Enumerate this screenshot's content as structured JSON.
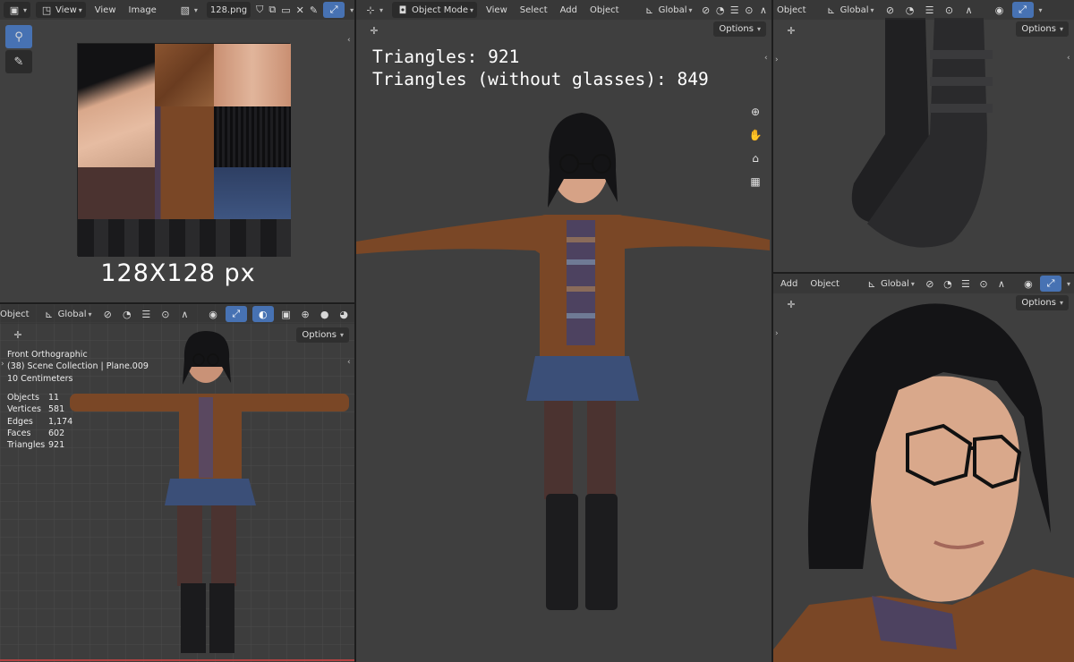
{
  "image_editor": {
    "view_menu": "View",
    "menu_view": "View",
    "menu_image": "Image",
    "image_name": "128.png",
    "texture_caption": "128X128 px"
  },
  "front_viewport": {
    "header_object": "Object",
    "orientation": "Global",
    "options_label": "Options",
    "view_name": "Front Orthographic",
    "collection": "(38) Scene Collection | Plane.009",
    "scale": "10 Centimeters",
    "stats": [
      {
        "label": "Objects",
        "value": "11"
      },
      {
        "label": "Vertices",
        "value": "581"
      },
      {
        "label": "Edges",
        "value": "1,174"
      },
      {
        "label": "Faces",
        "value": "602"
      },
      {
        "label": "Triangles",
        "value": "921"
      }
    ]
  },
  "main_viewport": {
    "mode": "Object Mode",
    "menus": [
      "View",
      "Select",
      "Add",
      "Object"
    ],
    "orientation": "Global",
    "options_label": "Options",
    "overlay_line1": "Triangles: 921",
    "overlay_line2": "Triangles (without glasses): 849"
  },
  "boots_viewport": {
    "header_object": "Object",
    "orientation": "Global",
    "options_label": "Options"
  },
  "face_viewport": {
    "menu_add": "Add",
    "menu_object": "Object",
    "orientation": "Global",
    "options_label": "Options"
  },
  "colors": {
    "jacket": "#7a4726",
    "skirt": "#3b4f78",
    "hair": "#141416",
    "skin": "#d9a88b",
    "viewport_bg": "#3d3d3d",
    "accent": "#4772b3"
  }
}
